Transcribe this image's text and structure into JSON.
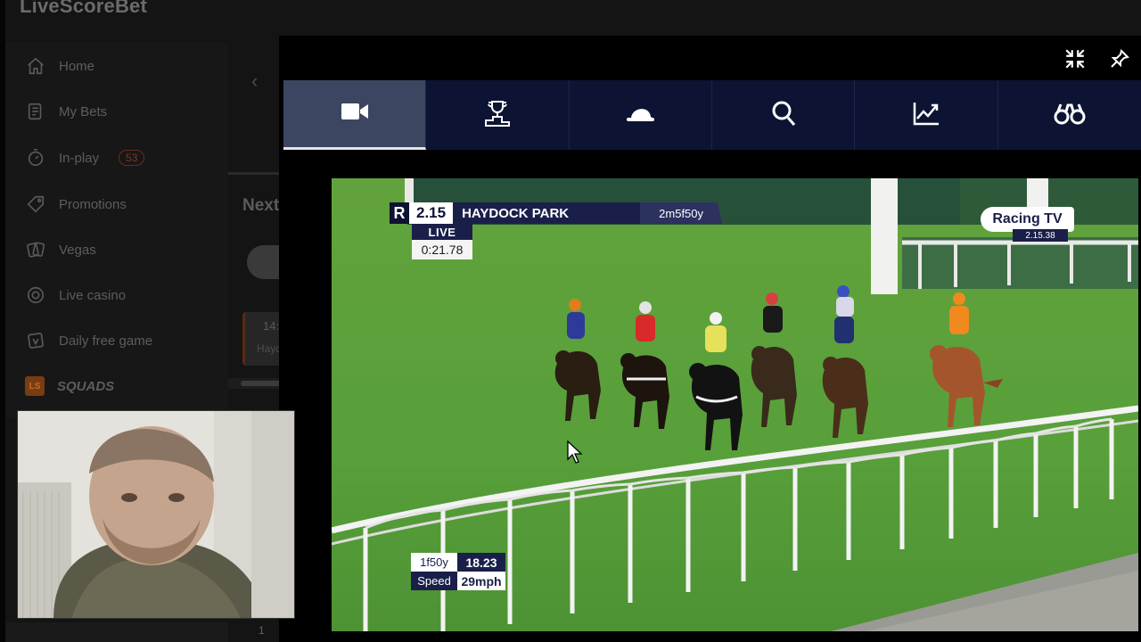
{
  "site": {
    "logo": "LiveScoreBet",
    "nav": [
      {
        "label": "Home",
        "icon": "home-icon"
      },
      {
        "label": "My Bets",
        "icon": "bets-slip-icon"
      },
      {
        "label": "In-play",
        "icon": "stopwatch-icon",
        "badge": "53"
      },
      {
        "label": "Promotions",
        "icon": "tag-icon"
      },
      {
        "label": "Vegas",
        "icon": "cards-icon"
      },
      {
        "label": "Live casino",
        "icon": "chip-icon"
      },
      {
        "label": "Daily free game",
        "icon": "gift-cards-icon"
      },
      {
        "label": "SQUADS",
        "icon": "squads-logo",
        "logo_text": "LS"
      }
    ],
    "next_heading": "Next",
    "race_card": {
      "time": "14:",
      "course": "Hayd"
    },
    "bottom_count": "1"
  },
  "player": {
    "controls": {
      "minimize_icon": "minimize-icon",
      "pin_icon": "pin-icon"
    },
    "tabs": [
      {
        "icon": "video-camera-icon",
        "active": true
      },
      {
        "icon": "podium-trophy-icon",
        "active": false
      },
      {
        "icon": "jockey-cap-icon",
        "active": false
      },
      {
        "icon": "search-icon",
        "active": false
      },
      {
        "icon": "trend-chart-icon",
        "active": false
      },
      {
        "icon": "binoculars-icon",
        "active": false
      }
    ],
    "overlay": {
      "brand_letter": "R",
      "race_time": "2.15",
      "course": "HAYDOCK PARK",
      "distance": "2m5f50y",
      "live_label": "LIVE",
      "elapsed": "0:21.78",
      "channel": "Racing TV",
      "channel_clock": "2.15.38",
      "sectional": {
        "distance_label": "1f50y",
        "distance_time": "18.23",
        "speed_label": "Speed",
        "speed_value": "29mph"
      }
    }
  },
  "colors": {
    "overlay_navy": "#1a1f4a",
    "tab_bar": "#0d1433",
    "tab_active": "#3c4660",
    "grass": "#5d9b3a"
  }
}
